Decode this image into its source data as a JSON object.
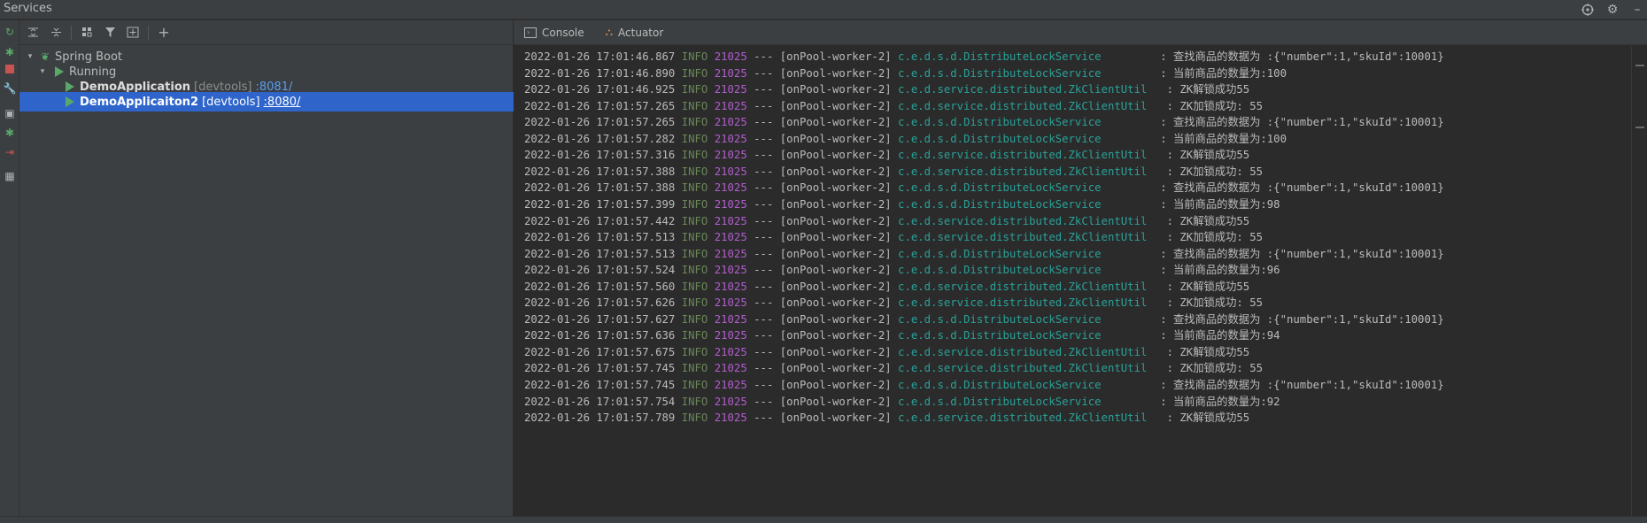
{
  "window": {
    "title": "Services"
  },
  "tree_toolbar": {
    "icons": [
      "expand-all-icon",
      "collapse-all-icon",
      "group-icon",
      "filter-icon",
      "new-group-icon",
      "add-icon"
    ]
  },
  "tree": {
    "root": {
      "label": "Spring Boot"
    },
    "group": {
      "label": "Running"
    },
    "apps": [
      {
        "name": "DemoApplication",
        "tag": "[devtools]",
        "port": ":8081/",
        "selected": false
      },
      {
        "name": "DemoApplicaiton2",
        "tag": "[devtools]",
        "port": ":8080/",
        "selected": true
      }
    ]
  },
  "console_tabs": [
    {
      "label": "Console",
      "icon": "console-icon"
    },
    {
      "label": "Actuator",
      "icon": "actuator-icon"
    }
  ],
  "log_lines": [
    {
      "ts": "2022-01-26 17:01:46.867",
      "level": "INFO",
      "pid": "21025",
      "sep": "---",
      "thread": "[onPool-worker-2]",
      "cls": "c.e.d.s.d.DistributeLockService        ",
      "msg": ": 查找商品的数据为 :{\"number\":1,\"skuId\":10001}"
    },
    {
      "ts": "2022-01-26 17:01:46.890",
      "level": "INFO",
      "pid": "21025",
      "sep": "---",
      "thread": "[onPool-worker-2]",
      "cls": "c.e.d.s.d.DistributeLockService        ",
      "msg": ": 当前商品的数量为:100"
    },
    {
      "ts": "2022-01-26 17:01:46.925",
      "level": "INFO",
      "pid": "21025",
      "sep": "---",
      "thread": "[onPool-worker-2]",
      "cls": "c.e.d.service.distributed.ZkClientUtil  ",
      "msg": ": ZK解锁成功55"
    },
    {
      "ts": "2022-01-26 17:01:57.265",
      "level": "INFO",
      "pid": "21025",
      "sep": "---",
      "thread": "[onPool-worker-2]",
      "cls": "c.e.d.service.distributed.ZkClientUtil  ",
      "msg": ": ZK加锁成功: 55"
    },
    {
      "ts": "2022-01-26 17:01:57.265",
      "level": "INFO",
      "pid": "21025",
      "sep": "---",
      "thread": "[onPool-worker-2]",
      "cls": "c.e.d.s.d.DistributeLockService        ",
      "msg": ": 查找商品的数据为 :{\"number\":1,\"skuId\":10001}"
    },
    {
      "ts": "2022-01-26 17:01:57.282",
      "level": "INFO",
      "pid": "21025",
      "sep": "---",
      "thread": "[onPool-worker-2]",
      "cls": "c.e.d.s.d.DistributeLockService        ",
      "msg": ": 当前商品的数量为:100"
    },
    {
      "ts": "2022-01-26 17:01:57.316",
      "level": "INFO",
      "pid": "21025",
      "sep": "---",
      "thread": "[onPool-worker-2]",
      "cls": "c.e.d.service.distributed.ZkClientUtil  ",
      "msg": ": ZK解锁成功55"
    },
    {
      "ts": "2022-01-26 17:01:57.388",
      "level": "INFO",
      "pid": "21025",
      "sep": "---",
      "thread": "[onPool-worker-2]",
      "cls": "c.e.d.service.distributed.ZkClientUtil  ",
      "msg": ": ZK加锁成功: 55"
    },
    {
      "ts": "2022-01-26 17:01:57.388",
      "level": "INFO",
      "pid": "21025",
      "sep": "---",
      "thread": "[onPool-worker-2]",
      "cls": "c.e.d.s.d.DistributeLockService        ",
      "msg": ": 查找商品的数据为 :{\"number\":1,\"skuId\":10001}"
    },
    {
      "ts": "2022-01-26 17:01:57.399",
      "level": "INFO",
      "pid": "21025",
      "sep": "---",
      "thread": "[onPool-worker-2]",
      "cls": "c.e.d.s.d.DistributeLockService        ",
      "msg": ": 当前商品的数量为:98"
    },
    {
      "ts": "2022-01-26 17:01:57.442",
      "level": "INFO",
      "pid": "21025",
      "sep": "---",
      "thread": "[onPool-worker-2]",
      "cls": "c.e.d.service.distributed.ZkClientUtil  ",
      "msg": ": ZK解锁成功55"
    },
    {
      "ts": "2022-01-26 17:01:57.513",
      "level": "INFO",
      "pid": "21025",
      "sep": "---",
      "thread": "[onPool-worker-2]",
      "cls": "c.e.d.service.distributed.ZkClientUtil  ",
      "msg": ": ZK加锁成功: 55"
    },
    {
      "ts": "2022-01-26 17:01:57.513",
      "level": "INFO",
      "pid": "21025",
      "sep": "---",
      "thread": "[onPool-worker-2]",
      "cls": "c.e.d.s.d.DistributeLockService        ",
      "msg": ": 查找商品的数据为 :{\"number\":1,\"skuId\":10001}"
    },
    {
      "ts": "2022-01-26 17:01:57.524",
      "level": "INFO",
      "pid": "21025",
      "sep": "---",
      "thread": "[onPool-worker-2]",
      "cls": "c.e.d.s.d.DistributeLockService        ",
      "msg": ": 当前商品的数量为:96"
    },
    {
      "ts": "2022-01-26 17:01:57.560",
      "level": "INFO",
      "pid": "21025",
      "sep": "---",
      "thread": "[onPool-worker-2]",
      "cls": "c.e.d.service.distributed.ZkClientUtil  ",
      "msg": ": ZK解锁成功55"
    },
    {
      "ts": "2022-01-26 17:01:57.626",
      "level": "INFO",
      "pid": "21025",
      "sep": "---",
      "thread": "[onPool-worker-2]",
      "cls": "c.e.d.service.distributed.ZkClientUtil  ",
      "msg": ": ZK加锁成功: 55"
    },
    {
      "ts": "2022-01-26 17:01:57.627",
      "level": "INFO",
      "pid": "21025",
      "sep": "---",
      "thread": "[onPool-worker-2]",
      "cls": "c.e.d.s.d.DistributeLockService        ",
      "msg": ": 查找商品的数据为 :{\"number\":1,\"skuId\":10001}"
    },
    {
      "ts": "2022-01-26 17:01:57.636",
      "level": "INFO",
      "pid": "21025",
      "sep": "---",
      "thread": "[onPool-worker-2]",
      "cls": "c.e.d.s.d.DistributeLockService        ",
      "msg": ": 当前商品的数量为:94"
    },
    {
      "ts": "2022-01-26 17:01:57.675",
      "level": "INFO",
      "pid": "21025",
      "sep": "---",
      "thread": "[onPool-worker-2]",
      "cls": "c.e.d.service.distributed.ZkClientUtil  ",
      "msg": ": ZK解锁成功55"
    },
    {
      "ts": "2022-01-26 17:01:57.745",
      "level": "INFO",
      "pid": "21025",
      "sep": "---",
      "thread": "[onPool-worker-2]",
      "cls": "c.e.d.service.distributed.ZkClientUtil  ",
      "msg": ": ZK加锁成功: 55"
    },
    {
      "ts": "2022-01-26 17:01:57.745",
      "level": "INFO",
      "pid": "21025",
      "sep": "---",
      "thread": "[onPool-worker-2]",
      "cls": "c.e.d.s.d.DistributeLockService        ",
      "msg": ": 查找商品的数据为 :{\"number\":1,\"skuId\":10001}"
    },
    {
      "ts": "2022-01-26 17:01:57.754",
      "level": "INFO",
      "pid": "21025",
      "sep": "---",
      "thread": "[onPool-worker-2]",
      "cls": "c.e.d.s.d.DistributeLockService        ",
      "msg": ": 当前商品的数量为:92"
    },
    {
      "ts": "2022-01-26 17:01:57.789",
      "level": "INFO",
      "pid": "21025",
      "sep": "---",
      "thread": "[onPool-worker-2]",
      "cls": "c.e.d.service.distributed.ZkClientUtil  ",
      "msg": ": ZK解锁成功55"
    }
  ],
  "colors": {
    "level": "#6a8759",
    "pid": "#b15dcc",
    "class": "#2aa198",
    "selection": "#2f65ca",
    "run": "#59a869",
    "stop": "#c75450"
  }
}
